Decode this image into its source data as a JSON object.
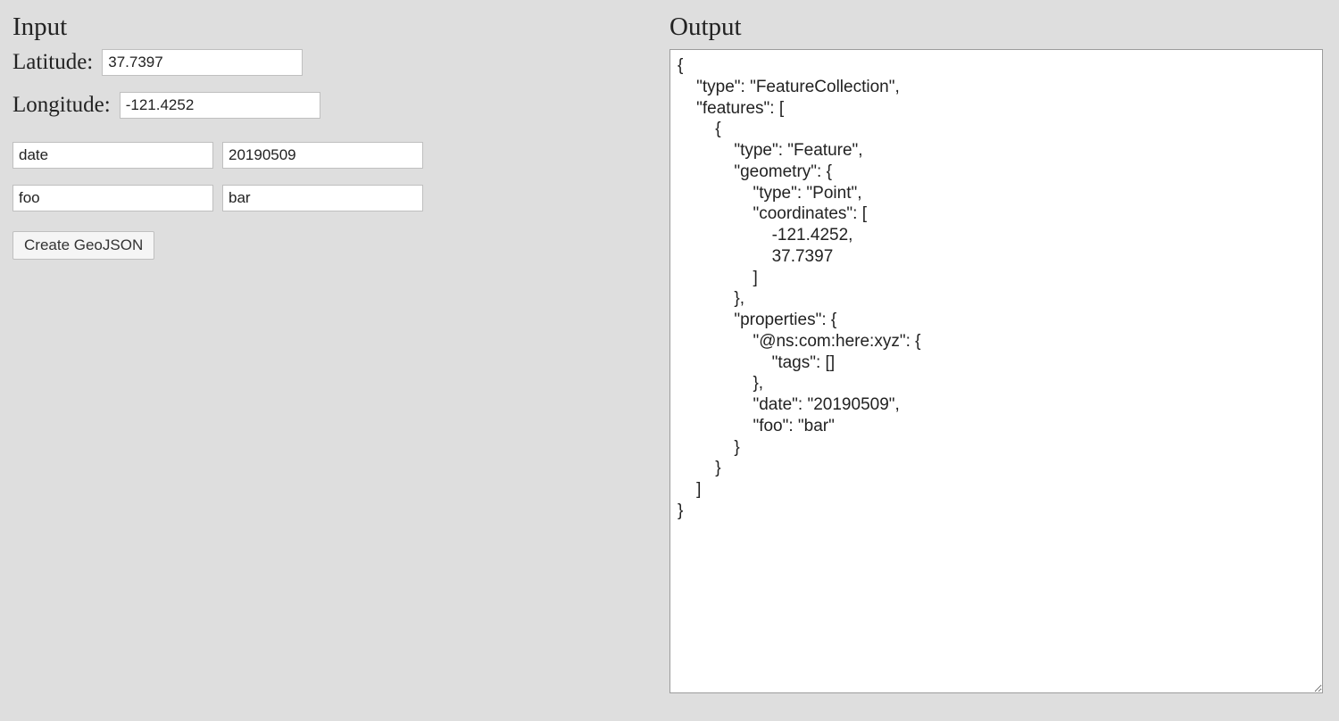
{
  "input": {
    "heading": "Input",
    "latitude_label": "Latitude:",
    "latitude_value": "37.7397",
    "longitude_label": "Longitude:",
    "longitude_value": "-121.4252",
    "kv_rows": [
      {
        "key": "date",
        "value": "20190509"
      },
      {
        "key": "foo",
        "value": "bar"
      }
    ],
    "button_label": "Create GeoJSON"
  },
  "output": {
    "heading": "Output",
    "text": "{\n    \"type\": \"FeatureCollection\",\n    \"features\": [\n        {\n            \"type\": \"Feature\",\n            \"geometry\": {\n                \"type\": \"Point\",\n                \"coordinates\": [\n                    -121.4252,\n                    37.7397\n                ]\n            },\n            \"properties\": {\n                \"@ns:com:here:xyz\": {\n                    \"tags\": []\n                },\n                \"date\": \"20190509\",\n                \"foo\": \"bar\"\n            }\n        }\n    ]\n}"
  }
}
